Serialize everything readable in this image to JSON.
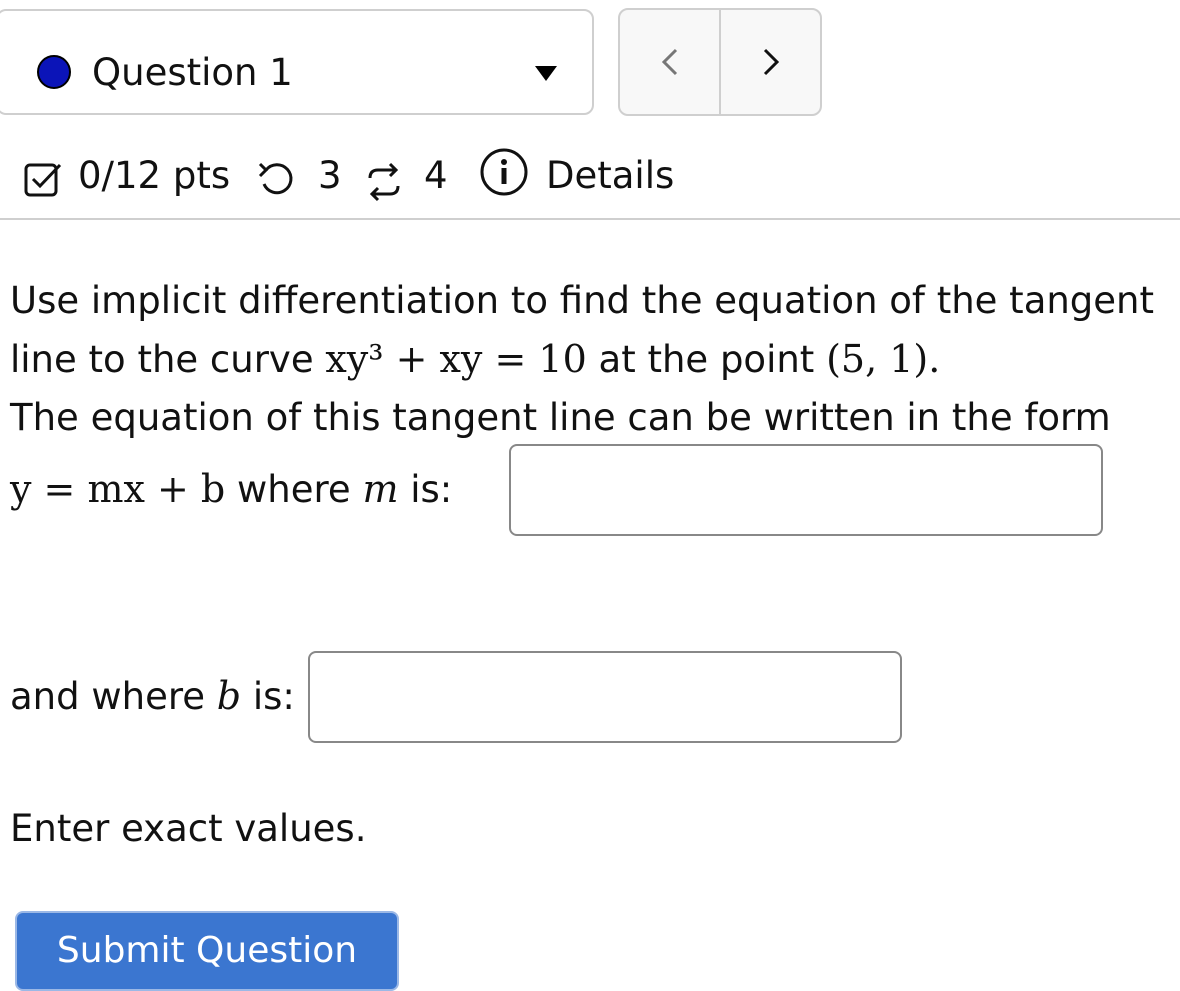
{
  "question_selector": {
    "label": "Question 1",
    "status_color": "#0b14b8"
  },
  "nav": {
    "prev_icon": "chevron-left-icon",
    "next_icon": "chevron-right-icon"
  },
  "status": {
    "points": "0/12 pts",
    "retries": "3",
    "attempts": "4",
    "details_label": "Details"
  },
  "question": {
    "intro": "Use implicit differentiation to find the equation of the tangent line to the curve",
    "equation": "xy³ + xy = 10",
    "at_point_text": "at the point",
    "point": "(5, 1).",
    "form_text": "The equation of this tangent line can be written in the form",
    "form_equation": "y = mx + b",
    "where_m": "where",
    "m_var": "m",
    "is_label": "is:",
    "and_where": "and where",
    "b_var": "b",
    "instruction": "Enter exact values."
  },
  "inputs": {
    "m_value": "",
    "b_value": ""
  },
  "submit_label": "Submit Question",
  "colors": {
    "accent": "#3b76d0",
    "border": "#cfcfcf"
  }
}
